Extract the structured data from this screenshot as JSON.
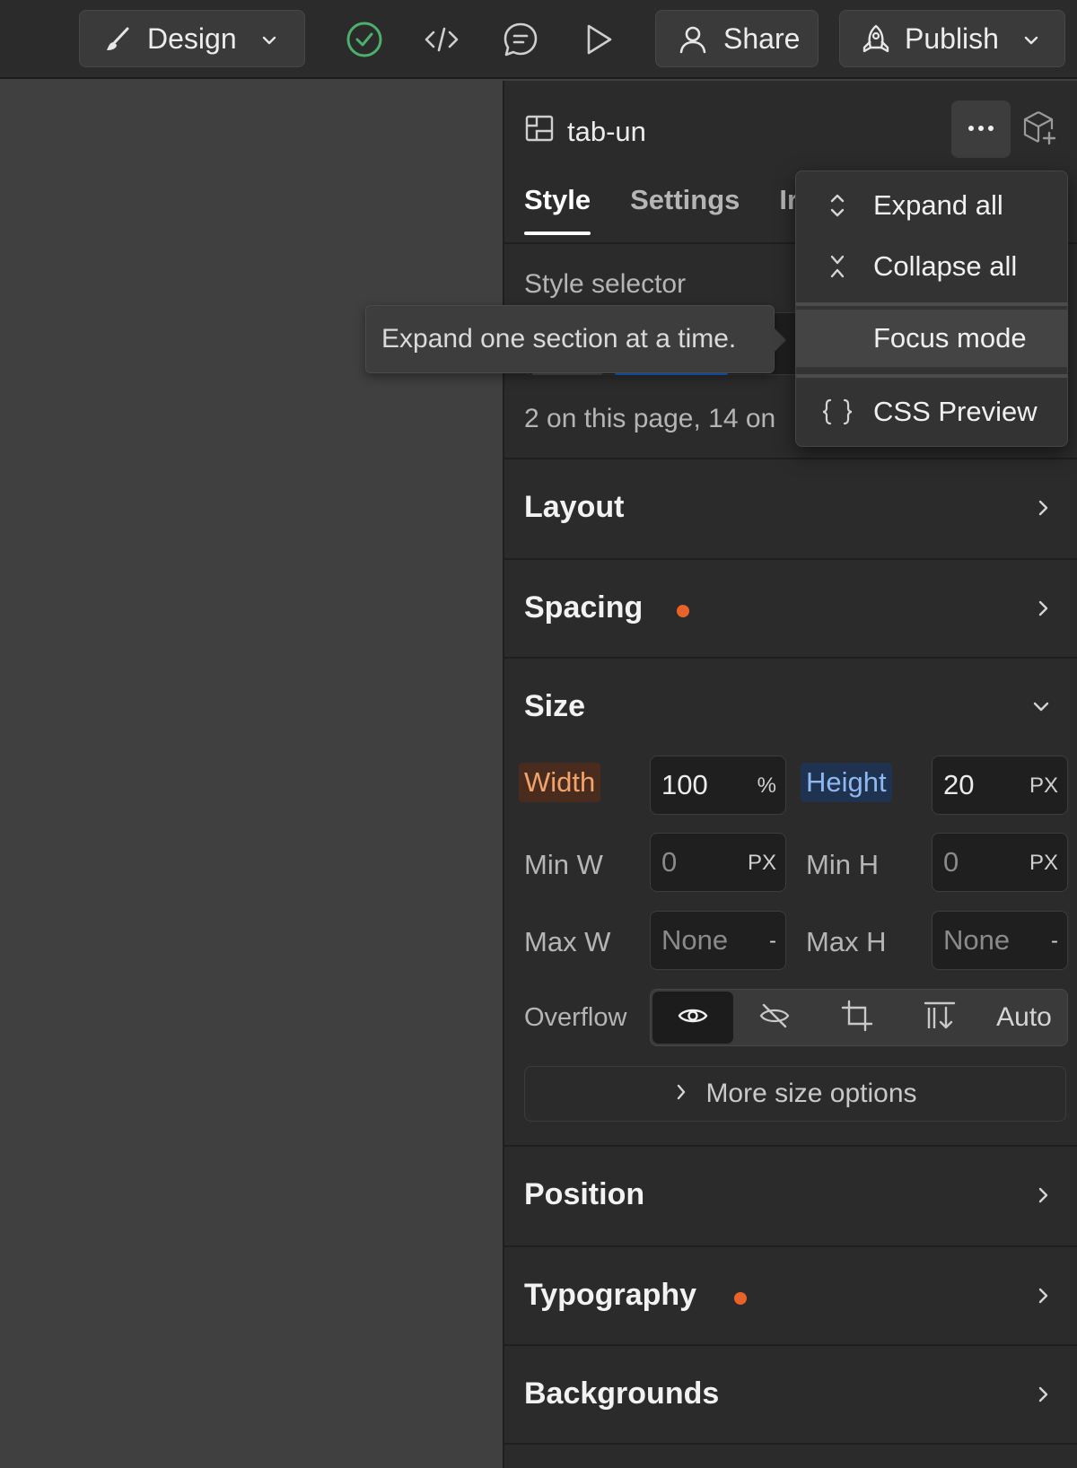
{
  "topbar": {
    "mode_label": "Design",
    "share_label": "Share",
    "publish_label": "Publish"
  },
  "panel": {
    "element_name": "tab-un",
    "tabs": [
      {
        "label": "Style",
        "active": true
      },
      {
        "label": "Settings",
        "active": false
      },
      {
        "label": "Ir",
        "active": false
      }
    ],
    "style_selector_label": "Style selector",
    "usage_text": "2 on this page, 14 on",
    "sections": {
      "layout": "Layout",
      "spacing": "Spacing",
      "size": "Size",
      "position": "Position",
      "typography": "Typography",
      "backgrounds": "Backgrounds"
    },
    "size": {
      "width_label": "Width",
      "width_value": "100",
      "width_unit": "%",
      "height_label": "Height",
      "height_value": "20",
      "height_unit": "PX",
      "min_w_label": "Min W",
      "min_w_value": "0",
      "min_w_unit": "PX",
      "min_h_label": "Min H",
      "min_h_value": "0",
      "min_h_unit": "PX",
      "max_w_label": "Max W",
      "max_w_value": "None",
      "max_w_unit": "-",
      "max_h_label": "Max H",
      "max_h_value": "None",
      "max_h_unit": "-",
      "overflow_label": "Overflow",
      "overflow_auto": "Auto",
      "more_options_label": "More size options"
    }
  },
  "tooltip": {
    "text": "Expand one section at a time."
  },
  "menu": {
    "items": [
      {
        "label": "Expand all",
        "icon": "expand-icon"
      },
      {
        "label": "Collapse all",
        "icon": "collapse-icon"
      },
      {
        "label": "Focus mode",
        "icon": ""
      },
      {
        "label": "CSS Preview",
        "icon": "braces-icon"
      }
    ]
  },
  "colors": {
    "modified_dot": "#e8622a",
    "check_green": "#4caf6a",
    "selector_blue": "#1665d6"
  }
}
